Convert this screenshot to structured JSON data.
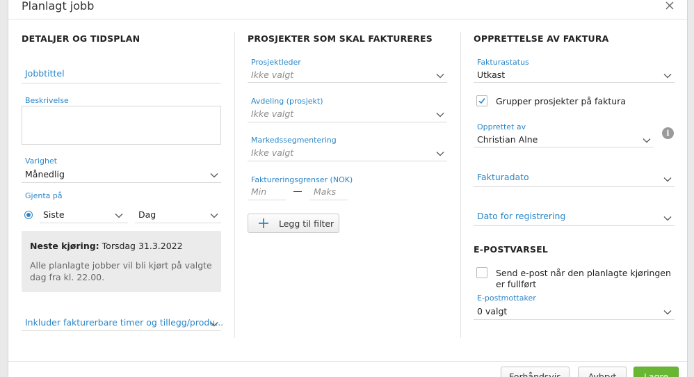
{
  "dialog": {
    "title": "Planlagt jobb",
    "close_icon": "close-icon"
  },
  "details": {
    "section_title": "DETALJER OG TIDSPLAN",
    "job_title_placeholder": "Jobbtittel",
    "description_label": "Beskrivelse",
    "duration_label": "Varighet",
    "duration_value": "Månedlig",
    "repeat_label": "Gjenta på",
    "repeat_position": "Siste",
    "repeat_unit": "Dag",
    "next_run_label": "Neste kjøring:",
    "next_run_value": "Torsdag 31.3.2022",
    "info_text": "Alle planlagte jobber vil bli kjørt på valgte dag fra kl. 22.00.",
    "include_label": "Inkluder fakturerbare timer og tillegg/produ..."
  },
  "projects": {
    "section_title": "PROSJEKTER SOM SKAL FAKTURERES",
    "project_manager_label": "Prosjektleder",
    "project_manager_value": "Ikke valgt",
    "department_label": "Avdeling (prosjekt)",
    "department_value": "Ikke valgt",
    "segment_label": "Markedssegmentering",
    "segment_value": "Ikke valgt",
    "limits_label": "Faktureringsgrenser (NOK)",
    "min_placeholder": "Min",
    "max_placeholder": "Maks",
    "add_filter_label": "Legg til filter"
  },
  "invoice": {
    "section_title": "OPPRETTELSE AV FAKTURA",
    "status_label": "Fakturastatus",
    "status_value": "Utkast",
    "group_label": "Grupper prosjekter på faktura",
    "group_checked": true,
    "created_by_label": "Opprettet av",
    "created_by_value": "Christian Alne",
    "invoice_date_label": "Fakturadato",
    "registration_date_label": "Dato for registrering"
  },
  "email": {
    "section_title": "E-POSTVARSEL",
    "send_label": "Send e-post når den planlagte kjøringen er fullført",
    "send_checked": false,
    "recipients_label": "E-postmottaker",
    "recipients_value": "0 valgt"
  },
  "footer": {
    "preview_label": "Forhåndsvis",
    "cancel_label": "Avbryt",
    "save_label": "Lagre"
  },
  "colors": {
    "accent": "#2a86c9",
    "primary_button": "#68b633",
    "info_box": "#ebebeb"
  }
}
